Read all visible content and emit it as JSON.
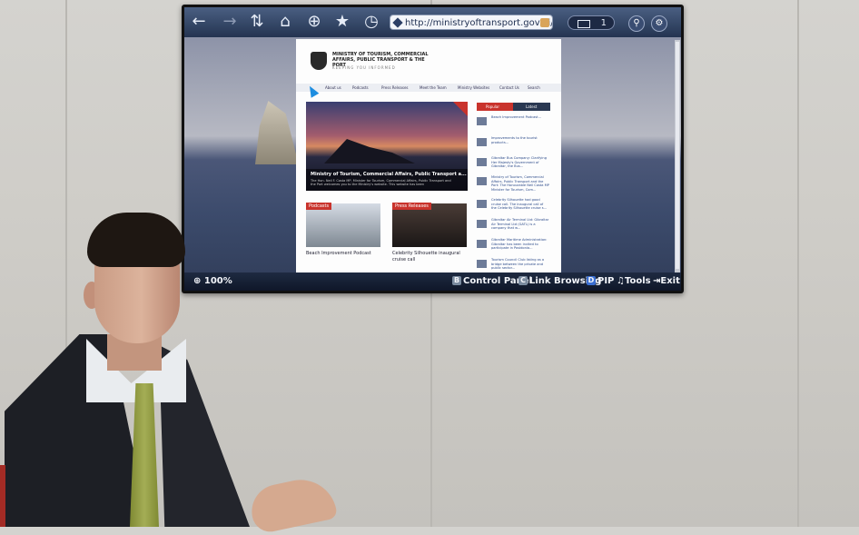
{
  "browser": {
    "url": "http://ministryoftransport.gov.gi/",
    "tab_count": "1",
    "zoom": "100%",
    "bottom_controls": {
      "control_panel": {
        "key": "B",
        "label": "Control Panel"
      },
      "link_browsing": {
        "key": "C",
        "label": "Link Browsing"
      },
      "pip": {
        "key": "D",
        "label": "PIP"
      },
      "tools": {
        "label": "Tools"
      },
      "exit": {
        "label": "Exit"
      }
    },
    "icons": [
      "back-icon",
      "forward-icon",
      "refresh-icon",
      "home-icon",
      "zoom-icon",
      "bookmark-star-icon",
      "history-icon",
      "search-icon",
      "settings-icon"
    ]
  },
  "website": {
    "header_line1": "MINISTRY OF TOURISM, COMMERCIAL",
    "header_line2": "AFFAIRS, PUBLIC TRANSPORT & THE PORT",
    "tagline": "KEEPING YOU INFORMED",
    "nav": [
      "About us",
      "Podcasts",
      "Press Releases",
      "Meet the Team",
      "Ministry Websites",
      "Contact Us",
      "Search"
    ],
    "hero_title": "Ministry of Tourism, Commercial Affairs, Public Transport a...",
    "hero_text": "The Hon. Neil F. Costa MP, Minister for Tourism, Commercial Affairs, Public Transport and the Port welcomes you to the Ministry's website. This website has been",
    "cards": [
      {
        "label": "Podcasts",
        "caption": "Beach Improvement Podcast"
      },
      {
        "label": "Press Releases",
        "caption": "Celebrity Silhouette inaugural cruise call"
      }
    ],
    "side_tabs": [
      "Popular",
      "Latest"
    ],
    "side_items": [
      "Beach Improvement Podcast...",
      "Improvements to the tourist products...",
      "Gibraltar Bus Company: Clarifying Her Majesty's Government of Gibraltar, the Bus...",
      "Ministry of Tourism, Commercial Affairs, Public Transport and the Port: The Honourable Neil Costa MP Minister for Tourism, Com...",
      "Celebrity Silhouette had good cruise call. The inaugural call of the Celebrity Silhouette cruise s...",
      "Gibraltar Air Terminal Ltd: Gibraltar Air Terminal Ltd (GATL) is a company that w...",
      "Gibraltar Maritime Administration: Gibraltar has been invited to participate in Posidonia...",
      "Tourism Council Club listing as a bridge between the private and public sector..."
    ]
  }
}
